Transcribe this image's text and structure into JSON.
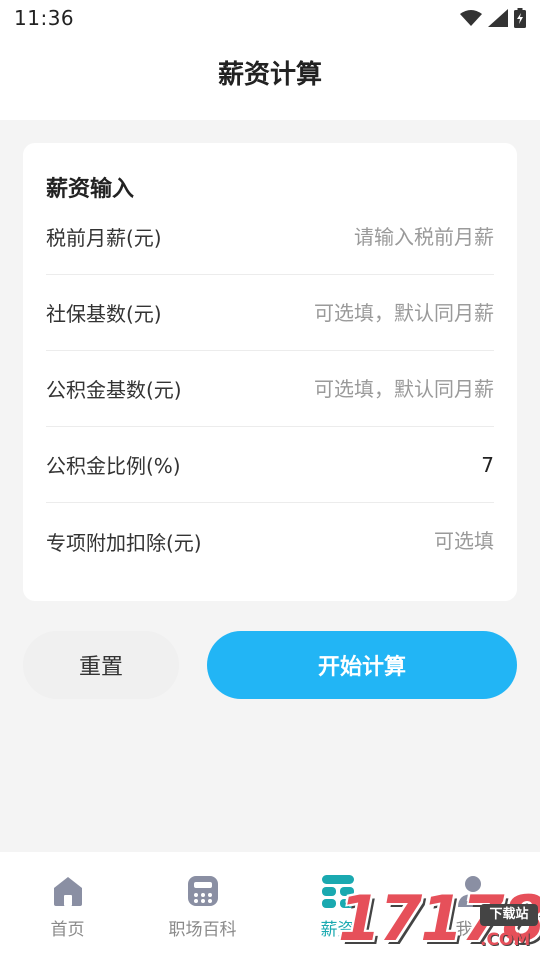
{
  "status_bar": {
    "time": "11:36"
  },
  "header": {
    "title": "薪资计算"
  },
  "form": {
    "title": "薪资输入",
    "rows": [
      {
        "label": "税前月薪(元)",
        "value": "",
        "placeholder": "请输入税前月薪"
      },
      {
        "label": "社保基数(元)",
        "value": "",
        "placeholder": "可选填，默认同月薪"
      },
      {
        "label": "公积金基数(元)",
        "value": "",
        "placeholder": "可选填，默认同月薪"
      },
      {
        "label": "公积金比例(%)",
        "value": "7",
        "placeholder": ""
      },
      {
        "label": "专项附加扣除(元)",
        "value": "",
        "placeholder": "可选填"
      }
    ]
  },
  "actions": {
    "reset_label": "重置",
    "calculate_label": "开始计算"
  },
  "tabbar": {
    "items": [
      {
        "label": "首页",
        "icon": "home-icon",
        "active": false
      },
      {
        "label": "职场百科",
        "icon": "calculator-icon",
        "active": false
      },
      {
        "label": "薪资",
        "icon": "salary-grid-icon",
        "active": true
      },
      {
        "label": "我的",
        "icon": "user-icon",
        "active": false
      }
    ]
  },
  "colors": {
    "accent": "#22b5f5",
    "active_tab": "#1aa9b0"
  },
  "watermark": {
    "number": "17178",
    "badge": "下载站",
    "domain": ".COM"
  }
}
